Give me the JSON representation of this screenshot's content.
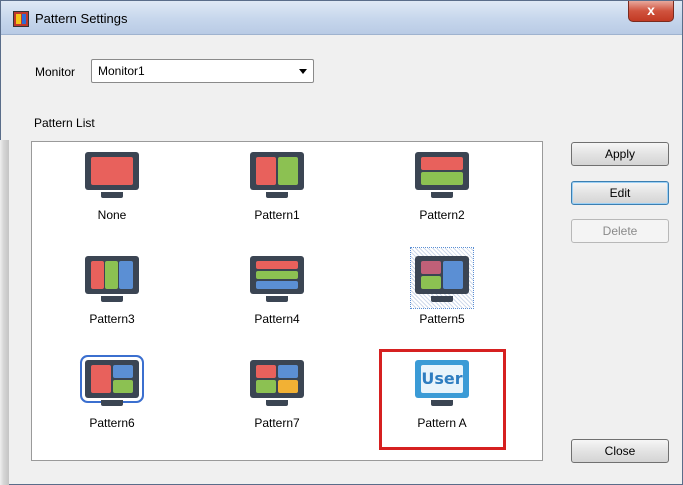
{
  "window": {
    "title": "Pattern Settings",
    "close_glyph": "x"
  },
  "monitor": {
    "label": "Monitor",
    "selected": "Monitor1"
  },
  "pattern_list": {
    "label": "Pattern List",
    "items": [
      {
        "label": "None"
      },
      {
        "label": "Pattern1"
      },
      {
        "label": "Pattern2"
      },
      {
        "label": "Pattern3"
      },
      {
        "label": "Pattern4"
      },
      {
        "label": "Pattern5"
      },
      {
        "label": "Pattern6"
      },
      {
        "label": "Pattern7"
      },
      {
        "label": "Pattern A",
        "icon_text": "User"
      }
    ]
  },
  "buttons": {
    "apply": "Apply",
    "edit": "Edit",
    "delete": "Delete",
    "close": "Close"
  },
  "colors": {
    "red": "#e8615c",
    "green": "#8cc152",
    "blue": "#5b8fd4",
    "yellow": "#f2b134",
    "highlight_box": "#d62020"
  }
}
